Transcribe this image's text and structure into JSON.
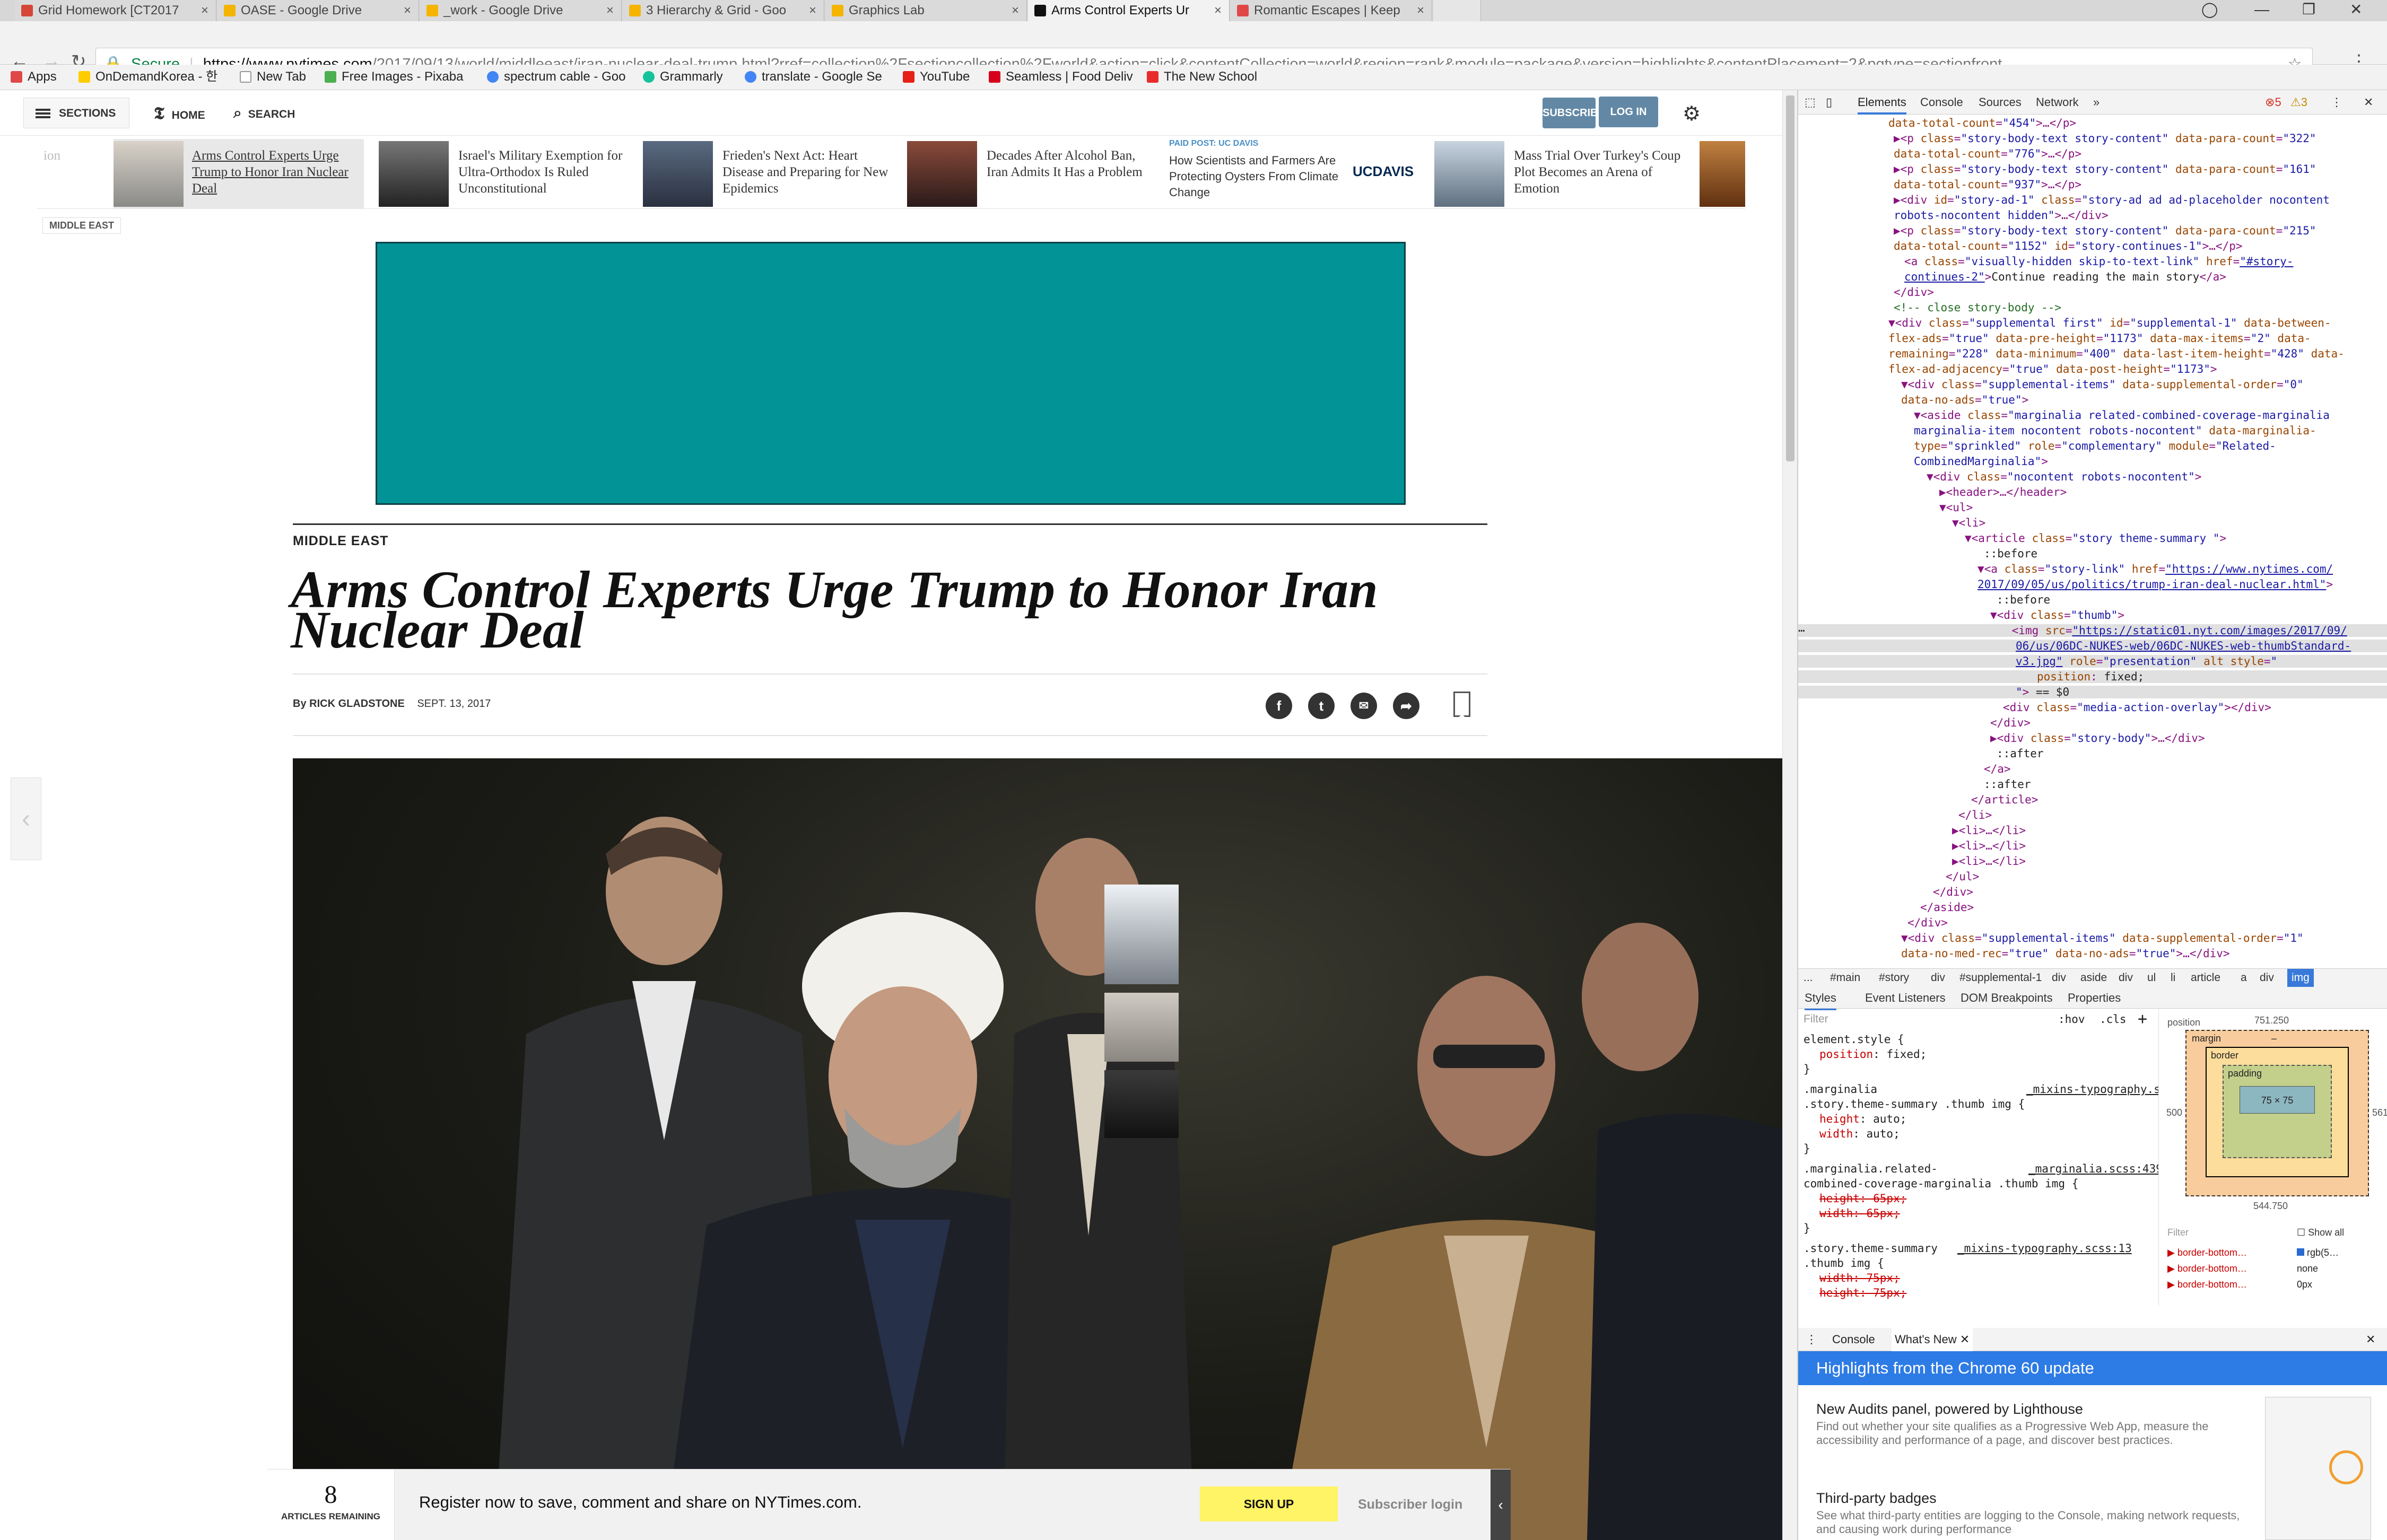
{
  "browser": {
    "tabs": [
      {
        "label": "Grid Homework [CT2017",
        "color": "#d44638"
      },
      {
        "label": "OASE - Google Drive",
        "color": "#f4b400"
      },
      {
        "label": "_work - Google Drive",
        "color": "#f4b400"
      },
      {
        "label": "3 Hierarchy & Grid - Goo",
        "color": "#f4b400"
      },
      {
        "label": "Graphics Lab",
        "color": "#f4b400"
      },
      {
        "label": "Arms Control Experts Ur",
        "color": "#111111"
      },
      {
        "label": "Romantic Escapes | Keep",
        "color": "#e04848"
      }
    ],
    "secure_label": "Secure",
    "url_host": "https://www.nytimes.com",
    "url_path": "/2017/09/13/world/middleeast/iran-nuclear-deal-trump.html?rref=collection%2Fsectioncollection%2Fworld&action=click&contentCollection=world&region=rank&module=package&version=highlights&contentPlacement=2&pgtype=sectionfront",
    "bookmarks": [
      {
        "label": "Apps",
        "color": "#e04848"
      },
      {
        "label": "OnDemandKorea - 한",
        "color": "#ffcc00"
      },
      {
        "label": "New Tab",
        "color": "#999999"
      },
      {
        "label": "Free Images - Pixaba",
        "color": "#4caf50"
      },
      {
        "label": "spectrum cable - Goo",
        "color": "#4285f4"
      },
      {
        "label": "Grammarly",
        "color": "#15c39a"
      },
      {
        "label": "translate - Google Se",
        "color": "#4285f4"
      },
      {
        "label": "YouTube",
        "color": "#e62117"
      },
      {
        "label": "Seamless | Food Deliv",
        "color": "#d6001c"
      },
      {
        "label": "The New School",
        "color": "#e82c2a"
      }
    ]
  },
  "nyt": {
    "sections_label": "SECTIONS",
    "home_label": "HOME",
    "search_label": "SEARCH",
    "subscribe_label": "SUBSCRIBE NOW",
    "login_label": "LOG IN",
    "ribbon_left_fragment": "ion",
    "ribbon": [
      {
        "title": "Arms Control Experts Urge Trump to Honor Iran Nuclear Deal"
      },
      {
        "title": "Israel's Military Exemption for Ultra-Orthodox Is Ruled Unconstitutional"
      },
      {
        "title": "Frieden's Next Act: Heart Disease and Preparing for New Epidemics"
      },
      {
        "title": "Decades After Alcohol Ban, Iran Admits It Has a Problem"
      },
      {
        "paid_post": "PAID POST: UC DAVIS",
        "title": "How Scientists and Farmers Are Protecting Oysters From Climate Change",
        "logo": "UCDAVIS"
      },
      {
        "title": "Mass Trial Over Turkey's Coup Plot Becomes an Arena of Emotion"
      }
    ],
    "ribbon_section": "MIDDLE EAST",
    "kicker": "MIDDLE EAST",
    "headline": "Arms Control Experts Urge Trump to Honor Iran Nuclear Deal",
    "byline_prefix": "By",
    "author": "RICK GLADSTONE",
    "date": "SEPT. 13, 2017",
    "register": {
      "count": "8",
      "count_label": "ARTICLES REMAINING",
      "message": "Register now to save, comment and share on NYTimes.com.",
      "signup": "SIGN UP",
      "subscriber_login": "Subscriber login"
    }
  },
  "devtools": {
    "tabs": [
      "Elements",
      "Console",
      "Sources",
      "Network",
      "»"
    ],
    "errors": "5",
    "warnings": "3",
    "breadcrumbs": [
      "...",
      "#main",
      "#story",
      "div",
      "#supplemental-1",
      "div",
      "aside",
      "div",
      "ul",
      "li",
      "article",
      "a",
      "div",
      "img"
    ],
    "subtabs": [
      "Styles",
      "Event Listeners",
      "DOM Breakpoints",
      "Properties"
    ],
    "filter_placeholder": "Filter",
    "hov_label": ":hov",
    "cls_label": ".cls",
    "box": {
      "position_label": "position",
      "margin": "margin",
      "border": "border",
      "padding": "padding",
      "content": "75 × 75",
      "top": "751.250",
      "left": "500",
      "right": "561",
      "bottom": "544.750",
      "dash": "–"
    },
    "computed_filter": "Filter",
    "show_all": "Show all",
    "computed_rows": [
      {
        "prop": "border-bottom…",
        "val": "rgb(5…"
      },
      {
        "prop": "border-bottom…",
        "val": "none"
      },
      {
        "prop": "border-bottom…",
        "val": "0px"
      }
    ],
    "drawer_tabs": [
      "Console",
      "What's New"
    ],
    "whats_new_header": "Highlights from the Chrome 60 update",
    "whats_new_items": [
      {
        "title": "New Audits panel, powered by Lighthouse",
        "desc": "Find out whether your site qualifies as a Progressive Web App, measure the accessibility and performance of a page, and discover best practices."
      },
      {
        "title": "Third-party badges",
        "desc": "See what third-party entities are logging to the Console, making network requests, and causing work during performance"
      }
    ]
  }
}
